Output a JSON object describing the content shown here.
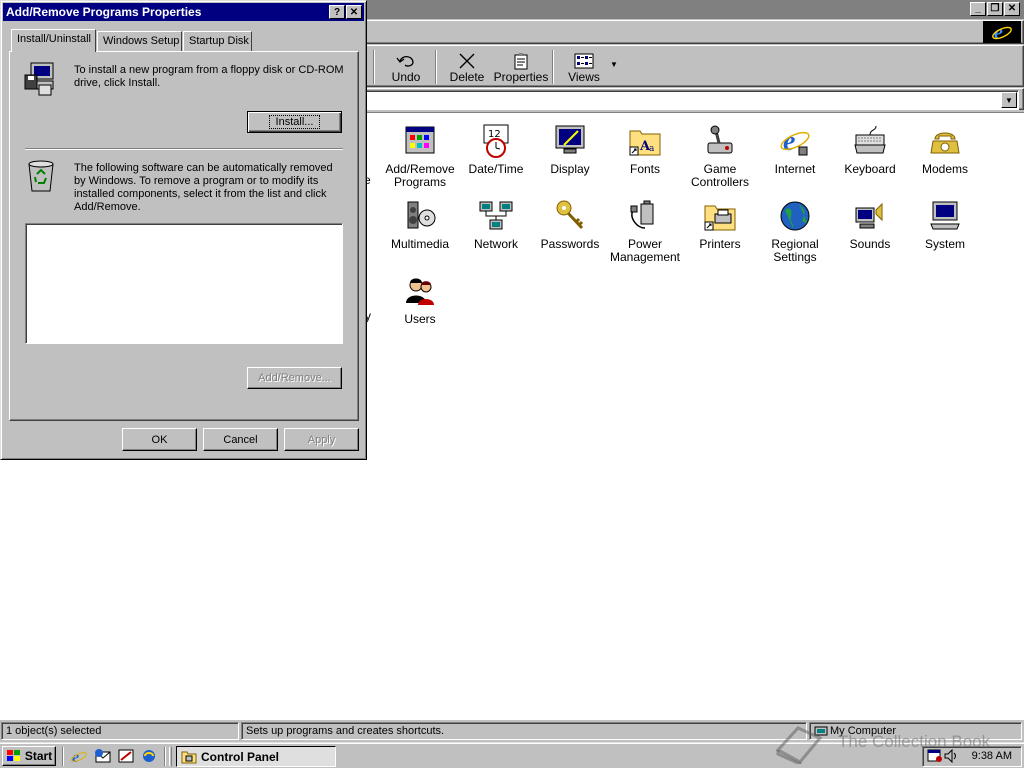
{
  "main_window": {
    "toolbar": [
      {
        "id": "undo",
        "label": "Undo",
        "icon": "undo-icon"
      },
      {
        "id": "delete",
        "label": "Delete",
        "icon": "delete-icon"
      },
      {
        "id": "properties",
        "label": "Properties",
        "icon": "properties-icon"
      },
      {
        "id": "views",
        "label": "Views",
        "icon": "views-icon"
      }
    ],
    "address_value": "",
    "items": [
      {
        "label": "Add/Remove Programs",
        "icon": "add-remove-programs-icon"
      },
      {
        "label": "Date/Time",
        "icon": "date-time-icon"
      },
      {
        "label": "Display",
        "icon": "display-icon"
      },
      {
        "label": "Fonts",
        "icon": "fonts-folder-icon"
      },
      {
        "label": "Game Controllers",
        "icon": "game-controllers-icon"
      },
      {
        "label": "Internet",
        "icon": "internet-icon"
      },
      {
        "label": "Keyboard",
        "icon": "keyboard-icon"
      },
      {
        "label": "Modems",
        "icon": "modems-icon"
      },
      {
        "label": "Multimedia",
        "icon": "multimedia-icon"
      },
      {
        "label": "Network",
        "icon": "network-icon"
      },
      {
        "label": "Passwords",
        "icon": "passwords-icon"
      },
      {
        "label": "Power Management",
        "icon": "power-management-icon"
      },
      {
        "label": "Printers",
        "icon": "printers-folder-icon"
      },
      {
        "label": "Regional Settings",
        "icon": "regional-settings-icon"
      },
      {
        "label": "Sounds",
        "icon": "sounds-icon"
      },
      {
        "label": "System",
        "icon": "system-icon"
      },
      {
        "label": "Users",
        "icon": "users-icon"
      }
    ],
    "status": {
      "selection": "1 object(s) selected",
      "description": "Sets up programs and creates shortcuts.",
      "zone": "My Computer"
    }
  },
  "dialog": {
    "title": "Add/Remove Programs Properties",
    "tabs": [
      "Install/Uninstall",
      "Windows Setup",
      "Startup Disk"
    ],
    "active_tab": "Install/Uninstall",
    "install_text": "To install a new program from a floppy disk or CD-ROM drive, click Install.",
    "install_button": "Install...",
    "remove_text": "The following software can be automatically removed by Windows. To remove a program or to modify its installed components, select it from the list and click Add/Remove.",
    "software_list": [],
    "add_remove_button": "Add/Remove...",
    "ok_button": "OK",
    "cancel_button": "Cancel",
    "apply_button": "Apply"
  },
  "taskbar": {
    "start_label": "Start",
    "task_label": "Control Panel",
    "clock": "9:38 AM"
  },
  "watermark": "The Collection Book",
  "colors": {
    "face": "#c0c0c0",
    "title_active": "#000080",
    "title_inactive": "#808080",
    "content_bg": "#ffffff"
  }
}
